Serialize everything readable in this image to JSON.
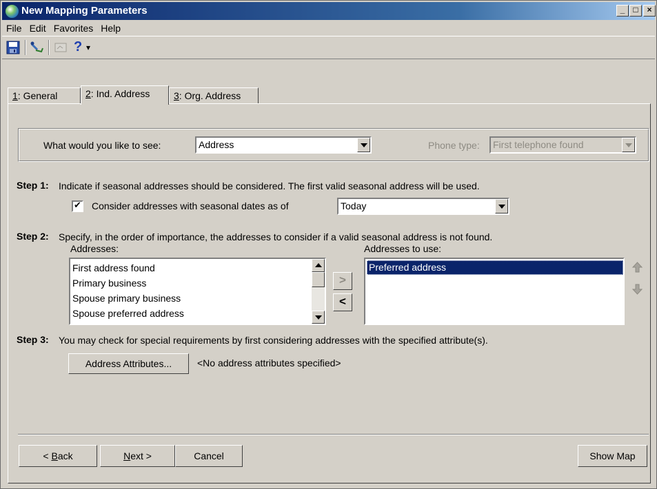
{
  "window": {
    "title": "New Mapping Parameters",
    "minimize_glyph": "_",
    "maximize_glyph": "□",
    "close_glyph": "×"
  },
  "menu": [
    "File",
    "Edit",
    "Favorites",
    "Help"
  ],
  "toolbar": {
    "icons": [
      "save-icon",
      "map-pin-icon",
      "disabled-map-icon",
      "help-icon"
    ],
    "help_glyph": "?",
    "dropdown_glyph": "▾"
  },
  "tabs": [
    {
      "key": "1",
      "label": ": General"
    },
    {
      "key": "2",
      "label": ": Ind. Address"
    },
    {
      "key": "3",
      "label": ": Org. Address"
    }
  ],
  "active_tab": 1,
  "see": {
    "label": "What would you like to see:",
    "value": "Address",
    "phone_label": "Phone type:",
    "phone_value": "First telephone found"
  },
  "step1": {
    "label": "Step 1:",
    "text": "Indicate if seasonal addresses should be considered.  The first valid seasonal address will be used.",
    "checkbox_label": "Consider addresses with seasonal dates as of",
    "checked": true,
    "date_value": "Today"
  },
  "step2": {
    "label": "Step 2:",
    "text": "Specify, in the order of importance, the addresses to consider if a valid seasonal address is not found.",
    "addresses_label": "Addresses:",
    "addresses": [
      "First address found",
      "Primary business",
      "Spouse primary business",
      "Spouse preferred address"
    ],
    "use_label": "Addresses to use:",
    "use_list": [
      "Preferred address"
    ],
    "add_glyph": ">",
    "remove_glyph": "<"
  },
  "step3": {
    "label": "Step 3:",
    "text": "You may check for special requirements by first considering addresses with the specified attribute(s).",
    "button": "Address Attributes...",
    "status": "<No address attributes specified>"
  },
  "footer": {
    "back_prefix": "< ",
    "back_key": "B",
    "back_rest": "ack",
    "next_key": "N",
    "next_rest": "ext >",
    "cancel": "Cancel",
    "show_map": "Show Map"
  },
  "colors": {
    "face": "#d4d0c8",
    "title_start": "#0a246a",
    "title_end": "#a6caf0",
    "selection": "#0a246a"
  }
}
